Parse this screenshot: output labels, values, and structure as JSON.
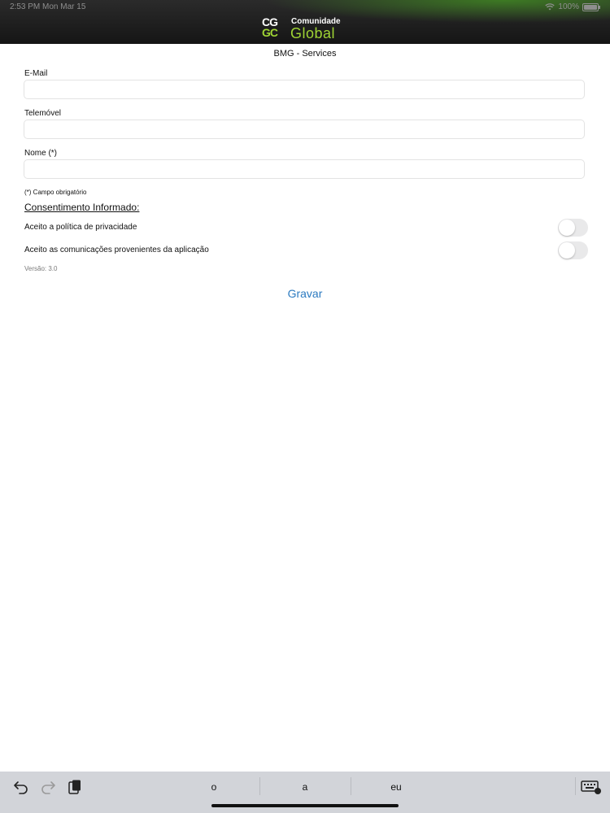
{
  "status_bar": {
    "time_date": "2:53 PM   Mon Mar 15",
    "battery": "100%"
  },
  "brand": {
    "mark_line1": "CG",
    "mark_line2": "GC",
    "name_top": "Comunidade",
    "name_bottom": "Global",
    "accent_color": "#9fd434"
  },
  "page": {
    "title": "BMG - Services"
  },
  "form": {
    "email": {
      "label": "E-Mail",
      "value": "",
      "placeholder": ""
    },
    "phone": {
      "label": "Telemóvel",
      "value": "",
      "placeholder": ""
    },
    "name": {
      "label": "Nome (*)",
      "value": "",
      "placeholder": ""
    },
    "required_note": "(*) Campo obrigatório"
  },
  "consent": {
    "heading": "Consentimento Informado:",
    "privacy": {
      "label": "Aceito a política de privacidade",
      "enabled": false
    },
    "communications": {
      "label": "Aceito as comunicações provenientes da aplicação",
      "enabled": false
    }
  },
  "version": "Versão: 3.0",
  "actions": {
    "save_label": "Gravar",
    "link_color": "#2b7ac0"
  },
  "keyboard_bar": {
    "icons": [
      "undo-icon",
      "redo-icon",
      "paste-icon",
      "keyboard-dismiss-icon"
    ],
    "suggestions": [
      "o",
      "a",
      "eu"
    ]
  }
}
